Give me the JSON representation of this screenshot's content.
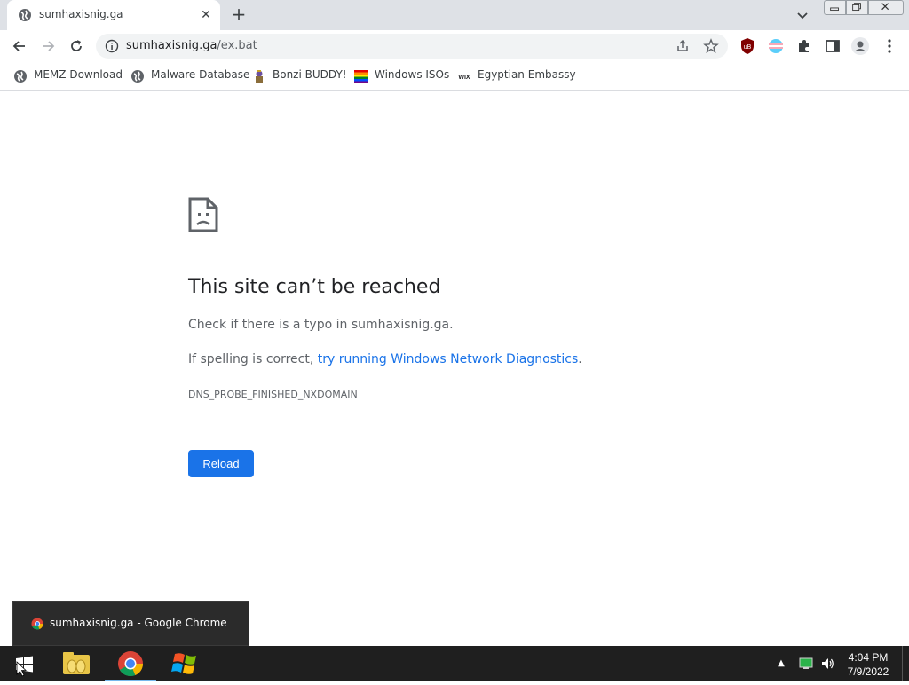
{
  "browser": {
    "tab": {
      "title": "sumhaxisnig.ga"
    },
    "omnibox": {
      "host": "sumhaxisnig.ga",
      "path": "/ex.bat"
    },
    "bookmarks": [
      {
        "label": "MEMZ Download",
        "icon": "globe-icon"
      },
      {
        "label": "Malware Database",
        "icon": "globe-icon"
      },
      {
        "label": "Bonzi BUDDY!",
        "icon": "bonzi-icon"
      },
      {
        "label": "Windows ISOs",
        "icon": "rainbow-flag-icon"
      },
      {
        "label": "Egyptian Embassy",
        "icon": "wix-icon"
      }
    ],
    "extensions": [
      "ublock-icon",
      "flag-icon",
      "puzzle-icon",
      "side-panel-icon",
      "profile-icon"
    ]
  },
  "error_page": {
    "heading": "This site can’t be reached",
    "line1": "Check if there is a typo in sumhaxisnig.ga.",
    "line2_prefix": "If spelling is correct, ",
    "line2_link": "try running Windows Network Diagnostics",
    "line2_suffix": ".",
    "error_code": "DNS_PROBE_FINISHED_NXDOMAIN",
    "reload_label": "Reload"
  },
  "taskbar": {
    "preview_title": "sumhaxisnig.ga - Google Chrome",
    "clock_time": "4:04 PM",
    "clock_date": "7/9/2022",
    "accent_color": "#1a73e8"
  }
}
